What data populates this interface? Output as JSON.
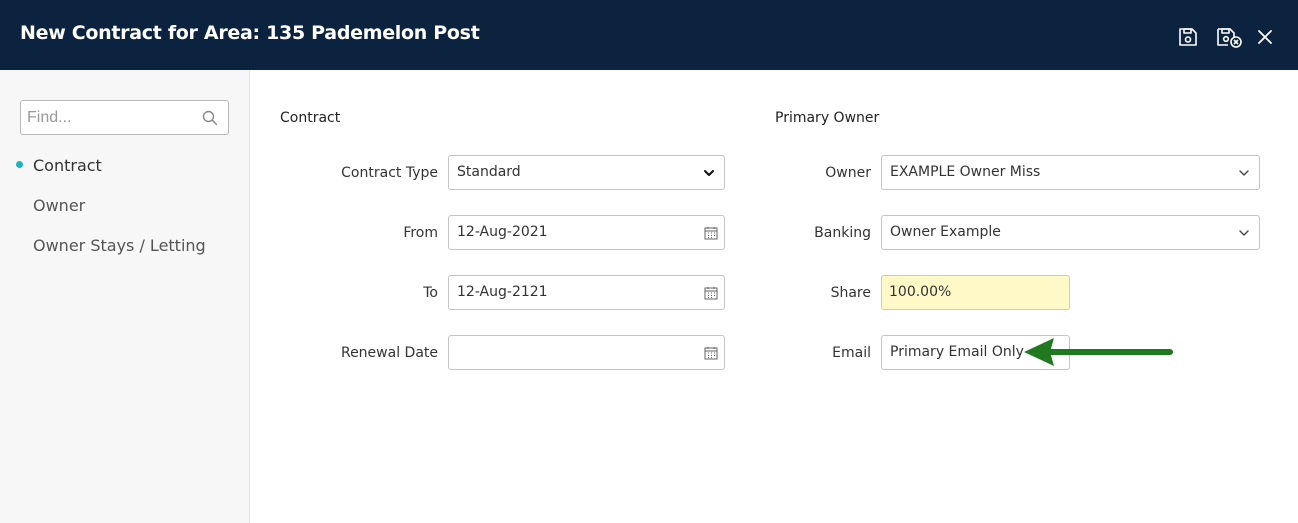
{
  "header": {
    "title": "New Contract for Area: 135 Pademelon Post"
  },
  "sidebar": {
    "find_placeholder": "Find...",
    "items": [
      {
        "label": "Contract",
        "active": true
      },
      {
        "label": "Owner",
        "active": false
      },
      {
        "label": "Owner Stays / Letting",
        "active": false
      }
    ]
  },
  "contract": {
    "section_title": "Contract",
    "contract_type": {
      "label": "Contract Type",
      "value": "Standard"
    },
    "from": {
      "label": "From",
      "value": "12-Aug-2021"
    },
    "to": {
      "label": "To",
      "value": "12-Aug-2121"
    },
    "renewal_date": {
      "label": "Renewal Date",
      "value": ""
    }
  },
  "primary_owner": {
    "section_title": "Primary Owner",
    "owner": {
      "label": "Owner",
      "value": "EXAMPLE Owner Miss"
    },
    "banking": {
      "label": "Banking",
      "value": "Owner Example"
    },
    "share": {
      "label": "Share",
      "value": "100.00%"
    },
    "email": {
      "label": "Email",
      "value": "Primary Email Only"
    }
  },
  "colors": {
    "header_bg": "#0c2340",
    "active_dot": "#1ab5c4",
    "share_bg": "#fff9c8",
    "arrow": "#1f7a1f"
  }
}
